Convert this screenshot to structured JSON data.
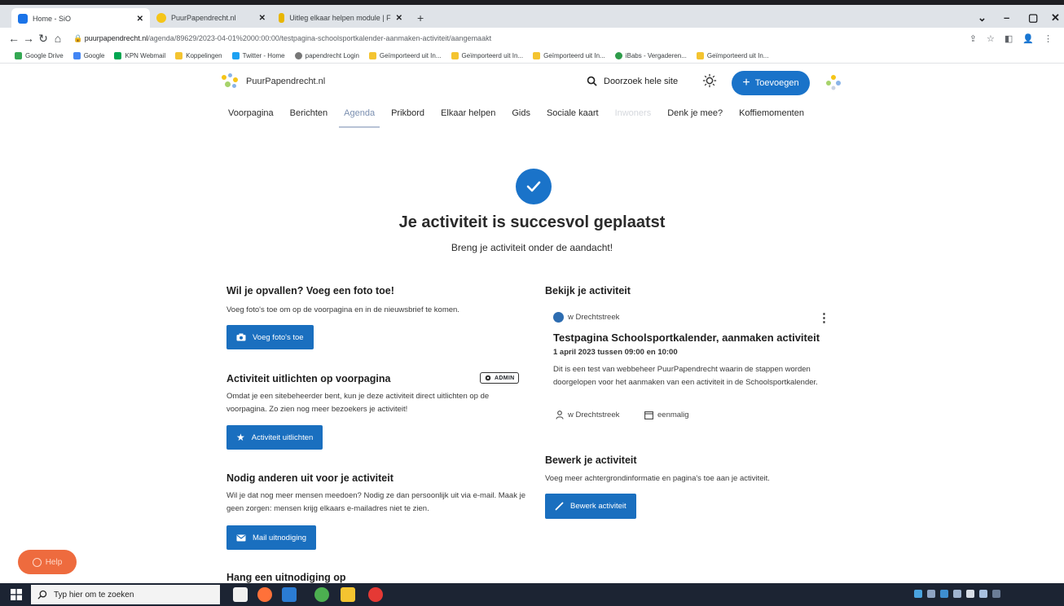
{
  "browser": {
    "tabs": [
      {
        "title": "Home - SiO",
        "color": "#1a73e8"
      },
      {
        "title": "PuurPapendrecht.nl",
        "color": "#f5c518"
      },
      {
        "title": "Uitleg elkaar helpen module | F",
        "color": "#e8b600"
      }
    ],
    "new_tab": "+",
    "url_host": "puurpapendrecht.nl",
    "url_path": "/agenda/89629/2023-04-01%2000:00:00/testpagina-schoolsportkalender-aanmaken-activiteit/aangemaakt",
    "bookmarks": [
      "Google Drive",
      "Google",
      "KPN Webmail",
      "Koppelingen",
      "Twitter - Home",
      "papendrecht Login",
      "Geïmporteerd uit In...",
      "Geïmporteerd uit In...",
      "Geïmporteerd uit In...",
      "iBabs - Vergaderen...",
      "Geïmporteerd uit In..."
    ]
  },
  "site": {
    "logo_text": "PuurPapendrecht.nl",
    "search_label": "Doorzoek hele site",
    "add_label": "Toevoegen",
    "nav": [
      {
        "label": "Voorpagina"
      },
      {
        "label": "Berichten"
      },
      {
        "label": "Agenda"
      },
      {
        "label": "Prikbord"
      },
      {
        "label": "Elkaar helpen"
      },
      {
        "label": "Gids"
      },
      {
        "label": "Sociale kaart"
      },
      {
        "label": "Inwoners"
      },
      {
        "label": "Denk je mee?"
      },
      {
        "label": "Koffiemomenten"
      }
    ]
  },
  "success": {
    "title": "Je activiteit is succesvol geplaatst",
    "subtitle": "Breng je activiteit onder de aandacht!"
  },
  "left": {
    "photo": {
      "title": "Wil je opvallen? Voeg een foto toe!",
      "text": "Voeg foto's toe om op de voorpagina en in de nieuwsbrief te komen.",
      "button": "Voeg foto's toe"
    },
    "highlight": {
      "title": "Activiteit uitlichten op voorpagina",
      "badge": "ADMIN",
      "text": "Omdat je een sitebeheerder bent, kun je deze activiteit direct uitlichten op de voorpagina. Zo zien nog meer bezoekers je activiteit!",
      "button": "Activiteit uitlichten"
    },
    "invite": {
      "title": "Nodig anderen uit voor je activiteit",
      "text": "Wil je dat nog meer mensen meedoen? Nodig ze dan persoonlijk uit via e-mail. Maak je geen zorgen: mensen krijg elkaars e-mailadres niet te zien.",
      "button": "Mail uitnodiging"
    },
    "poster_title": "Hang een uitnodiging op"
  },
  "right": {
    "view_title": "Bekijk je activiteit",
    "card": {
      "organizer": "w Drechtstreek",
      "title": "Testpagina Schoolsportkalender, aanmaken activiteit",
      "date": "1 april 2023 tussen 09:00 en 10:00",
      "description": "Dit is een test van webbeheer PuurPapendrecht waarin de stappen worden doorgelopen voor het aanmaken van een activiteit in de Schoolsportkalender.",
      "location": "w Drechtstreek",
      "frequency": "eenmalig"
    },
    "edit": {
      "title": "Bewerk je activiteit",
      "text": "Voeg meer achtergrondinformatie en pagina's toe aan je activiteit.",
      "button": "Bewerk activiteit"
    }
  },
  "help_label": "Help",
  "taskbar": {
    "search_placeholder": "Typ hier om te zoeken"
  },
  "colors": {
    "primary": "#1a73c9",
    "help": "#ee6b3e",
    "taskbar": "#1c2433"
  }
}
